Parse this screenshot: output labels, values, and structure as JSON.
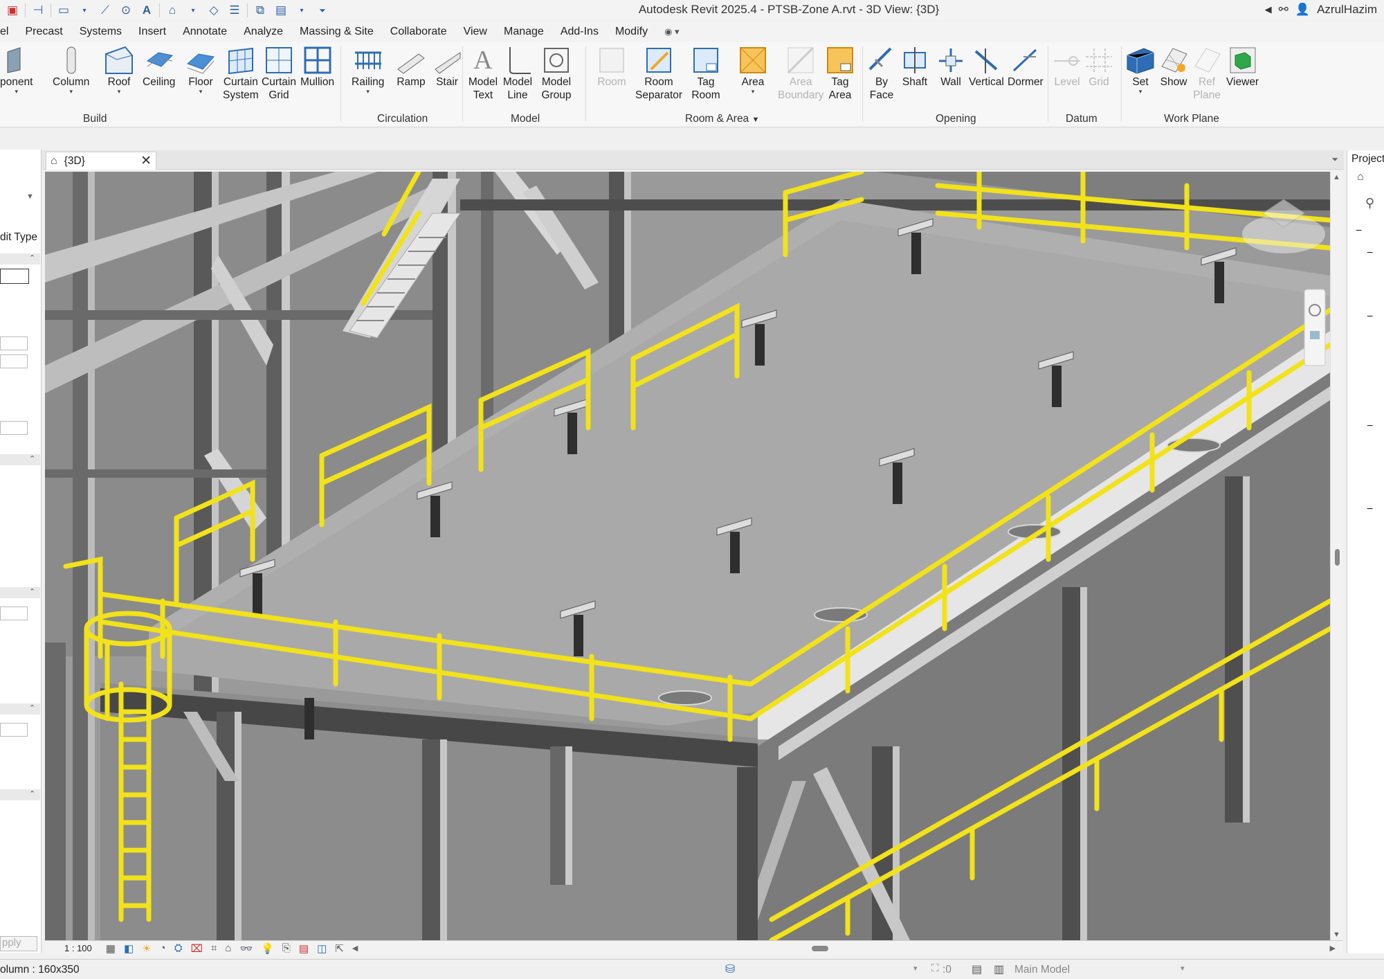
{
  "app_title": "Autodesk Revit 2025.4 - PTSB-Zone A.rvt - 3D View: {3D}",
  "user_name": "AzrulHazim",
  "menu": [
    "el",
    "Precast",
    "Systems",
    "Insert",
    "Annotate",
    "Analyze",
    "Massing & Site",
    "Collaborate",
    "View",
    "Manage",
    "Add-Ins",
    "Modify"
  ],
  "ribbon": {
    "build": {
      "title": "Build",
      "component": "ponent",
      "column": "Column",
      "roof": "Roof",
      "ceiling": "Ceiling",
      "floor": "Floor",
      "curtain_system_1": "Curtain",
      "curtain_system_2": "System",
      "curtain_grid_1": "Curtain",
      "curtain_grid_2": "Grid",
      "mullion": "Mullion"
    },
    "circulation": {
      "title": "Circulation",
      "railing": "Railing",
      "ramp": "Ramp",
      "stair": "Stair"
    },
    "model": {
      "title": "Model",
      "model_text_1": "Model",
      "model_text_2": "Text",
      "model_line_1": "Model",
      "model_line_2": "Line",
      "model_group_1": "Model",
      "model_group_2": "Group"
    },
    "room_area": {
      "title": "Room & Area",
      "room": "Room",
      "room_sep_1": "Room",
      "room_sep_2": "Separator",
      "tag_room_1": "Tag",
      "tag_room_2": "Room",
      "area": "Area",
      "area_boundary_1": "Area",
      "area_boundary_2": "Boundary",
      "tag_area_1": "Tag",
      "tag_area_2": "Area"
    },
    "opening": {
      "title": "Opening",
      "by_face_1": "By",
      "by_face_2": "Face",
      "shaft": "Shaft",
      "wall": "Wall",
      "vertical": "Vertical",
      "dormer": "Dormer"
    },
    "datum": {
      "title": "Datum",
      "level": "Level",
      "grid": "Grid"
    },
    "work_plane": {
      "title": "Work Plane",
      "set": "Set",
      "show": "Show",
      "ref_plane_1": "Ref",
      "ref_plane_2": "Plane",
      "viewer": "Viewer"
    }
  },
  "left_panel": {
    "edit_type": "dit Type",
    "apply": "pply"
  },
  "view_tab": {
    "label": "{3D}"
  },
  "right_panel": {
    "title": "Project"
  },
  "view_control": {
    "scale": "1 : 100"
  },
  "status": {
    "left": "olumn : 160x350",
    "coord": ":0",
    "model": "Main Model"
  },
  "colors": {
    "railing": "#f2e21a",
    "steel_dark": "#5a5a5a",
    "steel_light": "#bdbdbd",
    "slab": "#a8a8a8",
    "accent_blue": "#2d6db5",
    "accent_orange": "#f5a623"
  }
}
